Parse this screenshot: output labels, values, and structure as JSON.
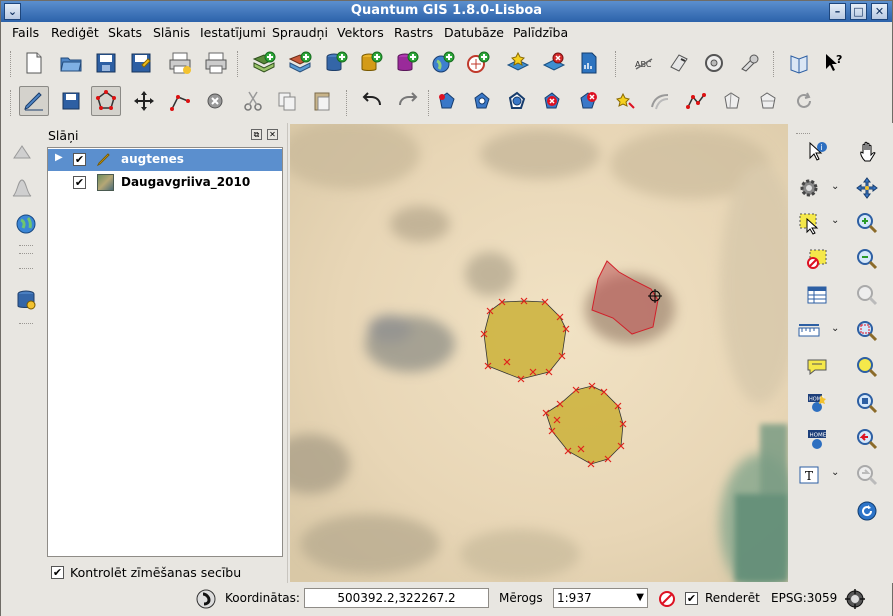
{
  "window": {
    "title": "Quantum GIS 1.8.0-Lisboa"
  },
  "menubar": {
    "items": [
      "Fails",
      "Rediģēt",
      "Skats",
      "Slānis",
      "Iestatījumi",
      "Spraudņi",
      "Vektors",
      "Rastrs",
      "Datubāze",
      "Palīdzība"
    ]
  },
  "layers_panel": {
    "title": "Slāņi",
    "layers": [
      {
        "name": "augtenes",
        "checked": true,
        "selected": true
      },
      {
        "name": "Daugavgriiva_2010",
        "checked": true,
        "selected": false
      }
    ],
    "render_order_label": "Kontrolēt zīmēšanas secību",
    "render_order_checked": true
  },
  "statusbar": {
    "coords_label": "Koordinātas:",
    "coords_value": "500392.2,322267.2",
    "scale_label": "Mērogs",
    "scale_value": "1:937",
    "render_label": "Renderēt",
    "render_checked": true,
    "crs": "EPSG:3059"
  },
  "colors": {
    "titlebar": "#2c62aa",
    "selection": "#5b8fce",
    "polygon_fill": "#c9ae2f",
    "polygon_selected_fill": "#c0585a",
    "vertex_marker": "#e0241c"
  },
  "icons": {
    "toolbar1": [
      "new-project-icon",
      "open-project-icon",
      "save-project-icon",
      "save-as-icon",
      "print-composer-icon",
      "print-icon",
      "add-vector-icon",
      "add-raster-icon",
      "add-postgis-icon",
      "add-spatialite-icon",
      "add-mssql-icon",
      "add-wms-icon",
      "add-wfs-icon",
      "new-shapefile-icon",
      "remove-layer-icon",
      "new-gpx-icon",
      "label-icon",
      "plugin-icon",
      "plugin-manager-icon",
      "plugin-settings-icon",
      "help-book-icon",
      "whats-this-icon"
    ],
    "toolbar2": [
      "toggle-edit-icon",
      "save-edits-icon",
      "digitize-polygon-icon",
      "move-feature-icon",
      "node-tool-icon",
      "delete-selected-icon",
      "cut-icon",
      "copy-icon",
      "paste-icon",
      "undo-icon",
      "redo-icon",
      "simplify-icon",
      "add-ring-icon",
      "add-part-icon",
      "delete-ring-icon",
      "delete-part-icon",
      "reshape-icon",
      "offset-curve-icon",
      "split-icon",
      "merge-icon",
      "merge-attributes-icon",
      "rotate-icon"
    ],
    "leftstrip": [
      "gps-icon",
      "histogram-icon",
      "globe-icon",
      "database-icon"
    ],
    "rightbar": [
      "identify-icon",
      "pan-icon",
      "settings-gear-icon",
      "move-map-icon",
      "select-icon",
      "zoom-in-icon",
      "deselect-icon",
      "zoom-out-icon",
      "attribute-table-icon",
      "zoom-full-icon",
      "measure-icon",
      "zoom-selection-icon",
      "map-tips-icon",
      "zoom-layer-icon",
      "new-bookmark-icon",
      "zoom-native-icon",
      "show-bookmarks-icon",
      "zoom-last-icon",
      "text-annotation-icon",
      "zoom-next-icon",
      "refresh-icon"
    ]
  }
}
